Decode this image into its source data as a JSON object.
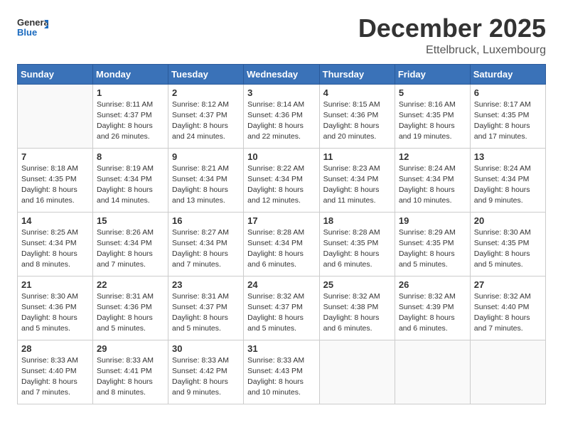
{
  "header": {
    "logo": {
      "general": "General",
      "blue": "Blue"
    },
    "title": "December 2025",
    "subtitle": "Ettelbruck, Luxembourg"
  },
  "weekdays": [
    "Sunday",
    "Monday",
    "Tuesday",
    "Wednesday",
    "Thursday",
    "Friday",
    "Saturday"
  ],
  "weeks": [
    [
      {
        "day": "",
        "info": ""
      },
      {
        "day": "1",
        "info": "Sunrise: 8:11 AM\nSunset: 4:37 PM\nDaylight: 8 hours\nand 26 minutes."
      },
      {
        "day": "2",
        "info": "Sunrise: 8:12 AM\nSunset: 4:37 PM\nDaylight: 8 hours\nand 24 minutes."
      },
      {
        "day": "3",
        "info": "Sunrise: 8:14 AM\nSunset: 4:36 PM\nDaylight: 8 hours\nand 22 minutes."
      },
      {
        "day": "4",
        "info": "Sunrise: 8:15 AM\nSunset: 4:36 PM\nDaylight: 8 hours\nand 20 minutes."
      },
      {
        "day": "5",
        "info": "Sunrise: 8:16 AM\nSunset: 4:35 PM\nDaylight: 8 hours\nand 19 minutes."
      },
      {
        "day": "6",
        "info": "Sunrise: 8:17 AM\nSunset: 4:35 PM\nDaylight: 8 hours\nand 17 minutes."
      }
    ],
    [
      {
        "day": "7",
        "info": "Sunrise: 8:18 AM\nSunset: 4:35 PM\nDaylight: 8 hours\nand 16 minutes."
      },
      {
        "day": "8",
        "info": "Sunrise: 8:19 AM\nSunset: 4:34 PM\nDaylight: 8 hours\nand 14 minutes."
      },
      {
        "day": "9",
        "info": "Sunrise: 8:21 AM\nSunset: 4:34 PM\nDaylight: 8 hours\nand 13 minutes."
      },
      {
        "day": "10",
        "info": "Sunrise: 8:22 AM\nSunset: 4:34 PM\nDaylight: 8 hours\nand 12 minutes."
      },
      {
        "day": "11",
        "info": "Sunrise: 8:23 AM\nSunset: 4:34 PM\nDaylight: 8 hours\nand 11 minutes."
      },
      {
        "day": "12",
        "info": "Sunrise: 8:24 AM\nSunset: 4:34 PM\nDaylight: 8 hours\nand 10 minutes."
      },
      {
        "day": "13",
        "info": "Sunrise: 8:24 AM\nSunset: 4:34 PM\nDaylight: 8 hours\nand 9 minutes."
      }
    ],
    [
      {
        "day": "14",
        "info": "Sunrise: 8:25 AM\nSunset: 4:34 PM\nDaylight: 8 hours\nand 8 minutes."
      },
      {
        "day": "15",
        "info": "Sunrise: 8:26 AM\nSunset: 4:34 PM\nDaylight: 8 hours\nand 7 minutes."
      },
      {
        "day": "16",
        "info": "Sunrise: 8:27 AM\nSunset: 4:34 PM\nDaylight: 8 hours\nand 7 minutes."
      },
      {
        "day": "17",
        "info": "Sunrise: 8:28 AM\nSunset: 4:34 PM\nDaylight: 8 hours\nand 6 minutes."
      },
      {
        "day": "18",
        "info": "Sunrise: 8:28 AM\nSunset: 4:35 PM\nDaylight: 8 hours\nand 6 minutes."
      },
      {
        "day": "19",
        "info": "Sunrise: 8:29 AM\nSunset: 4:35 PM\nDaylight: 8 hours\nand 5 minutes."
      },
      {
        "day": "20",
        "info": "Sunrise: 8:30 AM\nSunset: 4:35 PM\nDaylight: 8 hours\nand 5 minutes."
      }
    ],
    [
      {
        "day": "21",
        "info": "Sunrise: 8:30 AM\nSunset: 4:36 PM\nDaylight: 8 hours\nand 5 minutes."
      },
      {
        "day": "22",
        "info": "Sunrise: 8:31 AM\nSunset: 4:36 PM\nDaylight: 8 hours\nand 5 minutes."
      },
      {
        "day": "23",
        "info": "Sunrise: 8:31 AM\nSunset: 4:37 PM\nDaylight: 8 hours\nand 5 minutes."
      },
      {
        "day": "24",
        "info": "Sunrise: 8:32 AM\nSunset: 4:37 PM\nDaylight: 8 hours\nand 5 minutes."
      },
      {
        "day": "25",
        "info": "Sunrise: 8:32 AM\nSunset: 4:38 PM\nDaylight: 8 hours\nand 6 minutes."
      },
      {
        "day": "26",
        "info": "Sunrise: 8:32 AM\nSunset: 4:39 PM\nDaylight: 8 hours\nand 6 minutes."
      },
      {
        "day": "27",
        "info": "Sunrise: 8:32 AM\nSunset: 4:40 PM\nDaylight: 8 hours\nand 7 minutes."
      }
    ],
    [
      {
        "day": "28",
        "info": "Sunrise: 8:33 AM\nSunset: 4:40 PM\nDaylight: 8 hours\nand 7 minutes."
      },
      {
        "day": "29",
        "info": "Sunrise: 8:33 AM\nSunset: 4:41 PM\nDaylight: 8 hours\nand 8 minutes."
      },
      {
        "day": "30",
        "info": "Sunrise: 8:33 AM\nSunset: 4:42 PM\nDaylight: 8 hours\nand 9 minutes."
      },
      {
        "day": "31",
        "info": "Sunrise: 8:33 AM\nSunset: 4:43 PM\nDaylight: 8 hours\nand 10 minutes."
      },
      {
        "day": "",
        "info": ""
      },
      {
        "day": "",
        "info": ""
      },
      {
        "day": "",
        "info": ""
      }
    ]
  ]
}
